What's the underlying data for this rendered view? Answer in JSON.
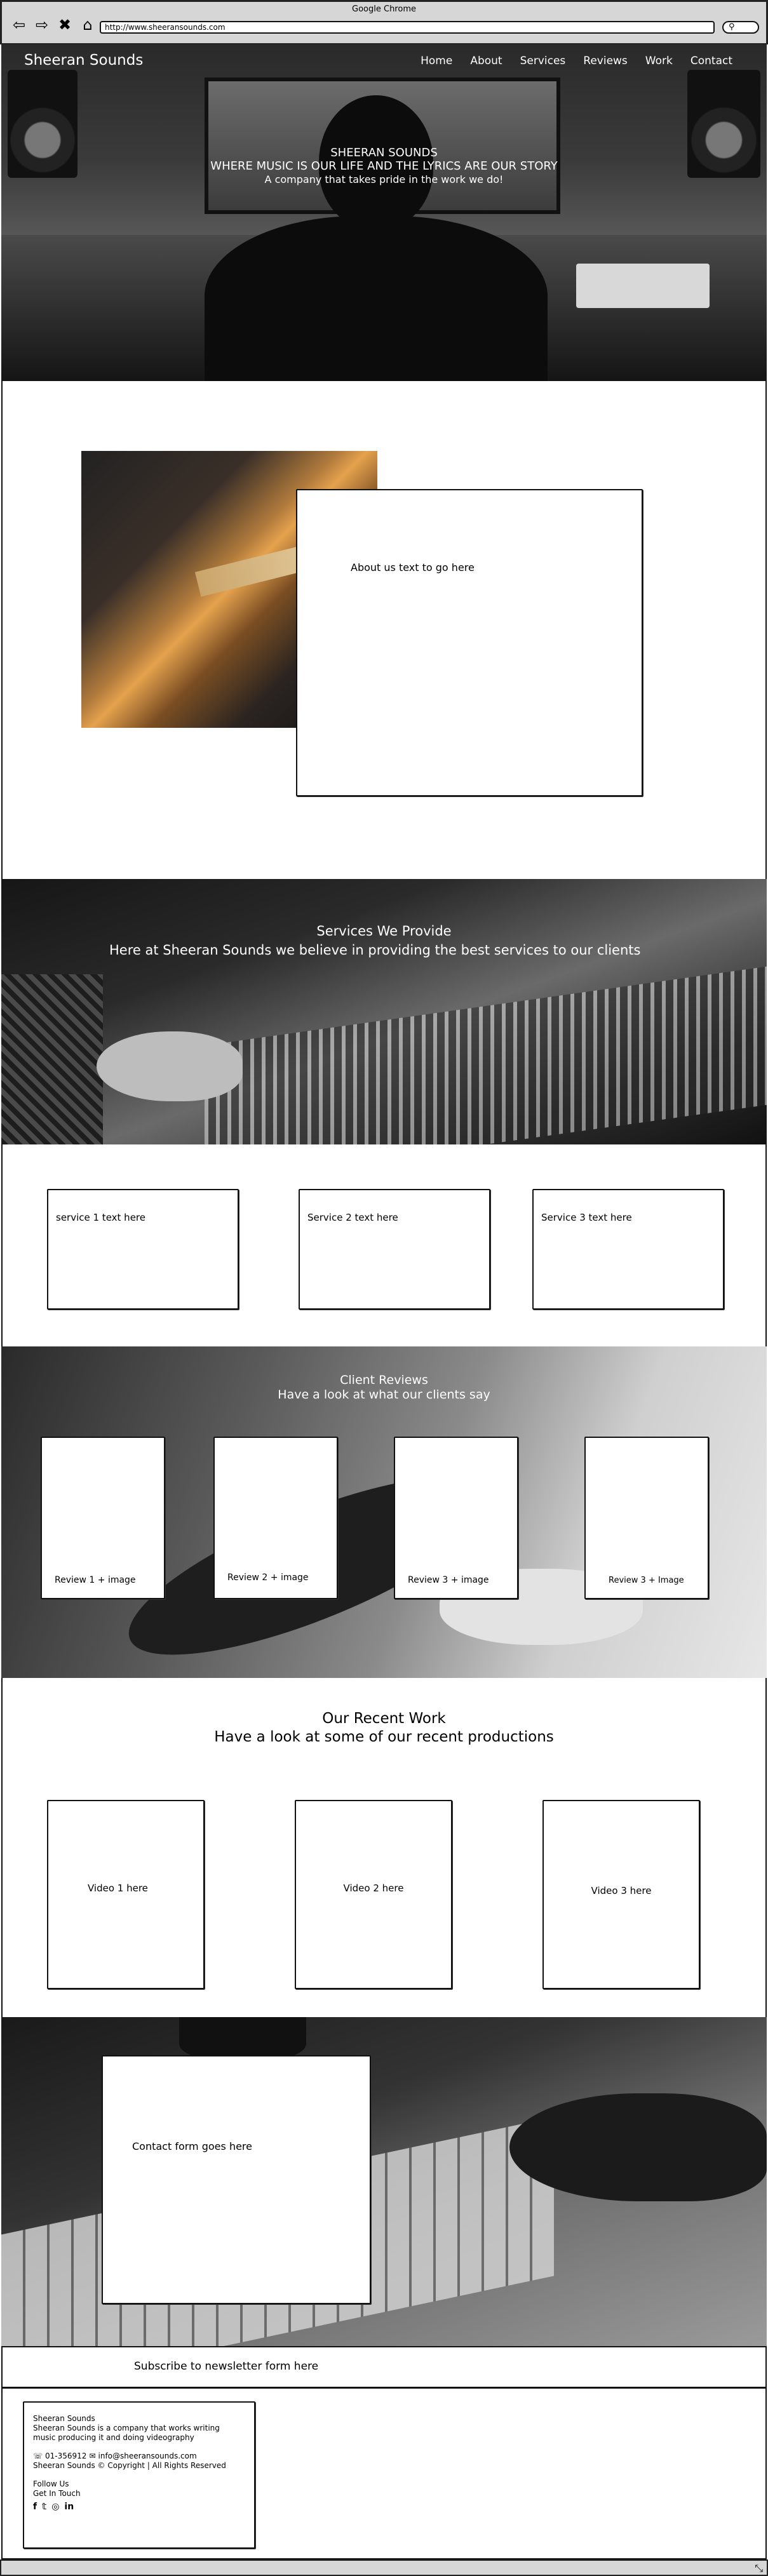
{
  "browser": {
    "window_title": "Google Chrome",
    "url": "http://www.sheeransounds.com",
    "icons": [
      "back-arrow-icon",
      "forward-arrow-icon",
      "close-icon",
      "home-icon",
      "search-icon"
    ]
  },
  "header": {
    "brand": "Sheeran Sounds",
    "nav": [
      "Home",
      "About",
      "Services",
      "Reviews",
      "Work",
      "Contact"
    ]
  },
  "hero": {
    "line1": "SHEERAN SOUNDS",
    "line2": "WHERE MUSIC IS OUR LIFE AND THE LYRICS ARE OUR STORY",
    "line3": "A company that takes pride in the work we do!"
  },
  "about": {
    "text": "About us text to go here"
  },
  "services_banner": {
    "title": "Services We Provide",
    "subtitle": "Here at Sheeran Sounds we believe in providing the best services to our clients"
  },
  "services": [
    {
      "text": "service 1 text here"
    },
    {
      "text": "Service 2 text here"
    },
    {
      "text": "Service 3 text here"
    }
  ],
  "reviews": {
    "title": "Client Reviews",
    "subtitle": "Have a look at what our clients say",
    "items": [
      "Review 1 + image",
      "Review 2 + image",
      "Review 3 + image",
      "Review 3 + Image"
    ]
  },
  "work": {
    "title": "Our Recent Work",
    "subtitle": "Have a look at some of our recent productions",
    "items": [
      "Video 1 here",
      "Video 2 here",
      "Video 3 here"
    ]
  },
  "contact": {
    "text": "Contact form goes here"
  },
  "newsletter": {
    "text": "Subscribe to newsletter form here"
  },
  "footer": {
    "company": "Sheeran Sounds",
    "description": "Sheeran Sounds is a company that works writing music producing it and doing videography",
    "phone": "01-356912",
    "email": "info@sheeransounds.com",
    "copyright": "Sheeran Sounds © Copyright | All Rights Reserved",
    "follow": "Follow Us",
    "get_in_touch": "Get In Touch",
    "social": [
      "facebook-icon",
      "twitter-icon",
      "instagram-icon",
      "linkedin-icon"
    ]
  }
}
